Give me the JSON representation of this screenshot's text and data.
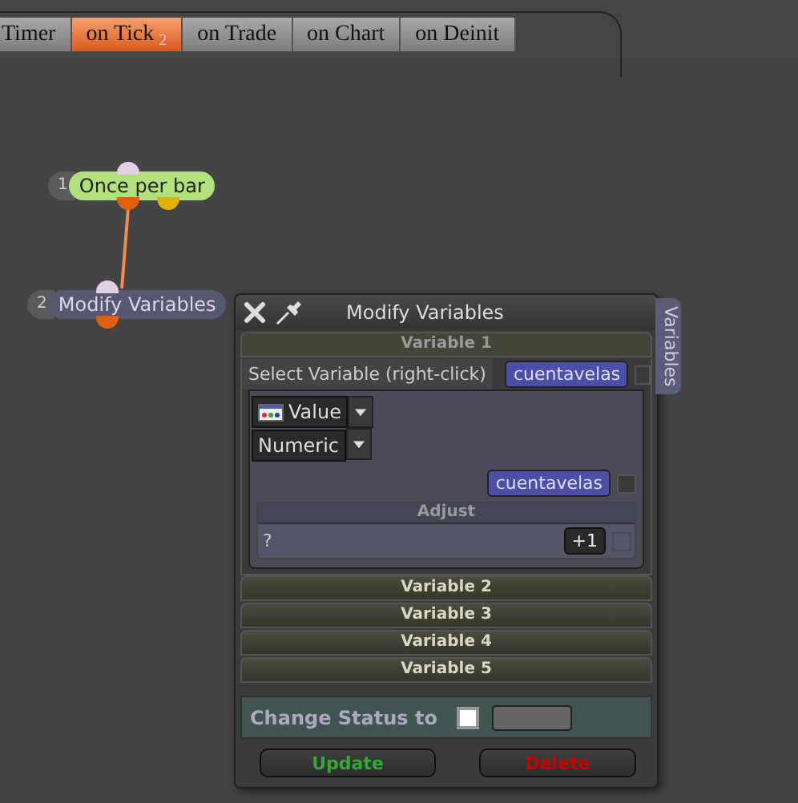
{
  "tabs": [
    {
      "label": "Timer",
      "selected": false
    },
    {
      "label": "on Tick",
      "badge": "2",
      "selected": true
    },
    {
      "label": "on Trade",
      "selected": false
    },
    {
      "label": "on Chart",
      "selected": false
    },
    {
      "label": "on Deinit",
      "selected": false
    }
  ],
  "nodes": [
    {
      "number": "1",
      "label": "Once per bar",
      "kind": "condition"
    },
    {
      "number": "2",
      "label": "Modify Variables",
      "kind": "action"
    }
  ],
  "panel": {
    "title": "Modify Variables",
    "side_tab": "Variables",
    "sections": [
      {
        "title": "Variable 1",
        "expanded": true,
        "select_label": "Select Variable (right-click)",
        "variable": "cuentavelas",
        "variable_checked": false,
        "source": "Value",
        "type": "Numeric",
        "value_variable": "cuentavelas",
        "value_checked": false,
        "adjust_title": "Adjust",
        "adjust_value": "?",
        "adjust_button": "+1",
        "adjust_checked": false
      },
      {
        "title": "Variable 2",
        "expanded": false
      },
      {
        "title": "Variable 3",
        "expanded": false
      },
      {
        "title": "Variable 4",
        "expanded": false
      },
      {
        "title": "Variable 5",
        "expanded": false
      }
    ],
    "status_label": "Change Status to",
    "status_checked": false,
    "buttons": [
      {
        "label": "Update",
        "kind": "update"
      },
      {
        "label": "Delete",
        "kind": "delete"
      }
    ]
  }
}
